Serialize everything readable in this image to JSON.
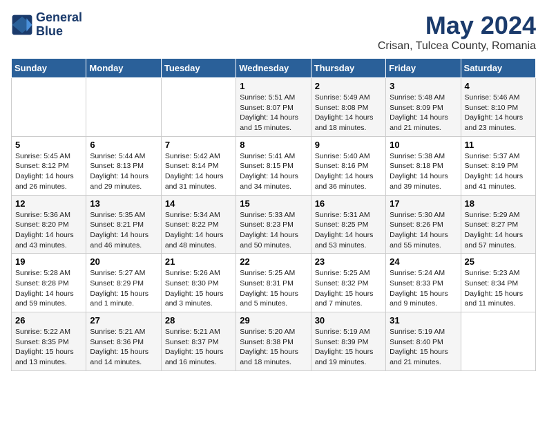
{
  "logo": {
    "line1": "General",
    "line2": "Blue"
  },
  "title": "May 2024",
  "subtitle": "Crisan, Tulcea County, Romania",
  "days_of_week": [
    "Sunday",
    "Monday",
    "Tuesday",
    "Wednesday",
    "Thursday",
    "Friday",
    "Saturday"
  ],
  "weeks": [
    [
      {
        "day": "",
        "detail": ""
      },
      {
        "day": "",
        "detail": ""
      },
      {
        "day": "",
        "detail": ""
      },
      {
        "day": "1",
        "detail": "Sunrise: 5:51 AM\nSunset: 8:07 PM\nDaylight: 14 hours\nand 15 minutes."
      },
      {
        "day": "2",
        "detail": "Sunrise: 5:49 AM\nSunset: 8:08 PM\nDaylight: 14 hours\nand 18 minutes."
      },
      {
        "day": "3",
        "detail": "Sunrise: 5:48 AM\nSunset: 8:09 PM\nDaylight: 14 hours\nand 21 minutes."
      },
      {
        "day": "4",
        "detail": "Sunrise: 5:46 AM\nSunset: 8:10 PM\nDaylight: 14 hours\nand 23 minutes."
      }
    ],
    [
      {
        "day": "5",
        "detail": "Sunrise: 5:45 AM\nSunset: 8:12 PM\nDaylight: 14 hours\nand 26 minutes."
      },
      {
        "day": "6",
        "detail": "Sunrise: 5:44 AM\nSunset: 8:13 PM\nDaylight: 14 hours\nand 29 minutes."
      },
      {
        "day": "7",
        "detail": "Sunrise: 5:42 AM\nSunset: 8:14 PM\nDaylight: 14 hours\nand 31 minutes."
      },
      {
        "day": "8",
        "detail": "Sunrise: 5:41 AM\nSunset: 8:15 PM\nDaylight: 14 hours\nand 34 minutes."
      },
      {
        "day": "9",
        "detail": "Sunrise: 5:40 AM\nSunset: 8:16 PM\nDaylight: 14 hours\nand 36 minutes."
      },
      {
        "day": "10",
        "detail": "Sunrise: 5:38 AM\nSunset: 8:18 PM\nDaylight: 14 hours\nand 39 minutes."
      },
      {
        "day": "11",
        "detail": "Sunrise: 5:37 AM\nSunset: 8:19 PM\nDaylight: 14 hours\nand 41 minutes."
      }
    ],
    [
      {
        "day": "12",
        "detail": "Sunrise: 5:36 AM\nSunset: 8:20 PM\nDaylight: 14 hours\nand 43 minutes."
      },
      {
        "day": "13",
        "detail": "Sunrise: 5:35 AM\nSunset: 8:21 PM\nDaylight: 14 hours\nand 46 minutes."
      },
      {
        "day": "14",
        "detail": "Sunrise: 5:34 AM\nSunset: 8:22 PM\nDaylight: 14 hours\nand 48 minutes."
      },
      {
        "day": "15",
        "detail": "Sunrise: 5:33 AM\nSunset: 8:23 PM\nDaylight: 14 hours\nand 50 minutes."
      },
      {
        "day": "16",
        "detail": "Sunrise: 5:31 AM\nSunset: 8:25 PM\nDaylight: 14 hours\nand 53 minutes."
      },
      {
        "day": "17",
        "detail": "Sunrise: 5:30 AM\nSunset: 8:26 PM\nDaylight: 14 hours\nand 55 minutes."
      },
      {
        "day": "18",
        "detail": "Sunrise: 5:29 AM\nSunset: 8:27 PM\nDaylight: 14 hours\nand 57 minutes."
      }
    ],
    [
      {
        "day": "19",
        "detail": "Sunrise: 5:28 AM\nSunset: 8:28 PM\nDaylight: 14 hours\nand 59 minutes."
      },
      {
        "day": "20",
        "detail": "Sunrise: 5:27 AM\nSunset: 8:29 PM\nDaylight: 15 hours\nand 1 minute."
      },
      {
        "day": "21",
        "detail": "Sunrise: 5:26 AM\nSunset: 8:30 PM\nDaylight: 15 hours\nand 3 minutes."
      },
      {
        "day": "22",
        "detail": "Sunrise: 5:25 AM\nSunset: 8:31 PM\nDaylight: 15 hours\nand 5 minutes."
      },
      {
        "day": "23",
        "detail": "Sunrise: 5:25 AM\nSunset: 8:32 PM\nDaylight: 15 hours\nand 7 minutes."
      },
      {
        "day": "24",
        "detail": "Sunrise: 5:24 AM\nSunset: 8:33 PM\nDaylight: 15 hours\nand 9 minutes."
      },
      {
        "day": "25",
        "detail": "Sunrise: 5:23 AM\nSunset: 8:34 PM\nDaylight: 15 hours\nand 11 minutes."
      }
    ],
    [
      {
        "day": "26",
        "detail": "Sunrise: 5:22 AM\nSunset: 8:35 PM\nDaylight: 15 hours\nand 13 minutes."
      },
      {
        "day": "27",
        "detail": "Sunrise: 5:21 AM\nSunset: 8:36 PM\nDaylight: 15 hours\nand 14 minutes."
      },
      {
        "day": "28",
        "detail": "Sunrise: 5:21 AM\nSunset: 8:37 PM\nDaylight: 15 hours\nand 16 minutes."
      },
      {
        "day": "29",
        "detail": "Sunrise: 5:20 AM\nSunset: 8:38 PM\nDaylight: 15 hours\nand 18 minutes."
      },
      {
        "day": "30",
        "detail": "Sunrise: 5:19 AM\nSunset: 8:39 PM\nDaylight: 15 hours\nand 19 minutes."
      },
      {
        "day": "31",
        "detail": "Sunrise: 5:19 AM\nSunset: 8:40 PM\nDaylight: 15 hours\nand 21 minutes."
      },
      {
        "day": "",
        "detail": ""
      }
    ]
  ]
}
